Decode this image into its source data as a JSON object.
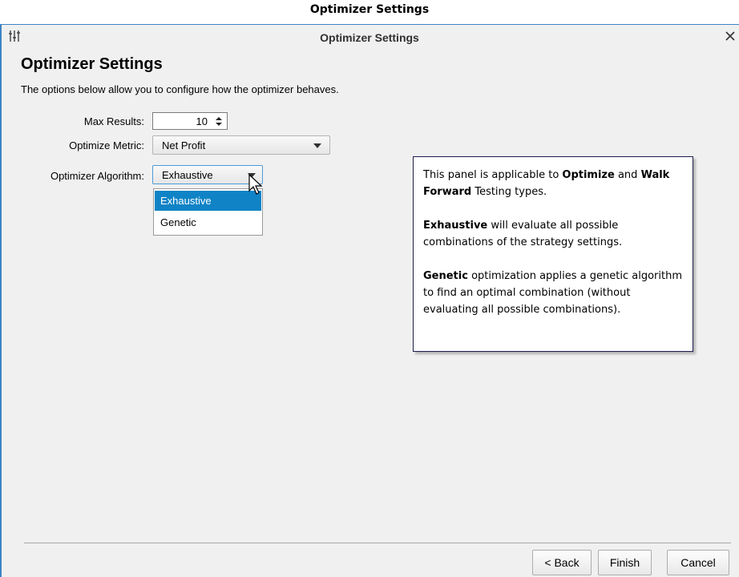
{
  "caption": "Optimizer Settings",
  "window": {
    "title": "Optimizer Settings",
    "icon": "sliders-icon",
    "close_icon": "close-icon"
  },
  "page": {
    "heading": "Optimizer Settings",
    "description": "The options below allow you to configure how the optimizer behaves."
  },
  "form": {
    "max_results": {
      "label": "Max Results:",
      "value": "10"
    },
    "optimize_metric": {
      "label": "Optimize Metric:",
      "value": "Net Profit"
    },
    "optimizer_algorithm": {
      "label": "Optimizer Algorithm:",
      "value": "Exhaustive",
      "options": [
        "Exhaustive",
        "Genetic"
      ],
      "highlighted_option": "Exhaustive"
    }
  },
  "info_panel": {
    "p1": {
      "t1": "This panel is applicable to ",
      "b1": "Optimize",
      "t2": " and ",
      "b2": "Walk Forward",
      "t3": " Testing types."
    },
    "p2": {
      "b1": "Exhaustive",
      "t1": " will evaluate all possible combinations of the strategy settings."
    },
    "p3": {
      "b1": "Genetic",
      "t1": " optimization applies a genetic algorithm to find an optimal combination (without evaluating all possible combinations)."
    }
  },
  "footer": {
    "back": "< Back",
    "finish": "Finish",
    "cancel": "Cancel"
  },
  "colors": {
    "accent": "#0f83c6",
    "window_border": "#3d84c6",
    "panel_border": "#1d1d4f"
  }
}
